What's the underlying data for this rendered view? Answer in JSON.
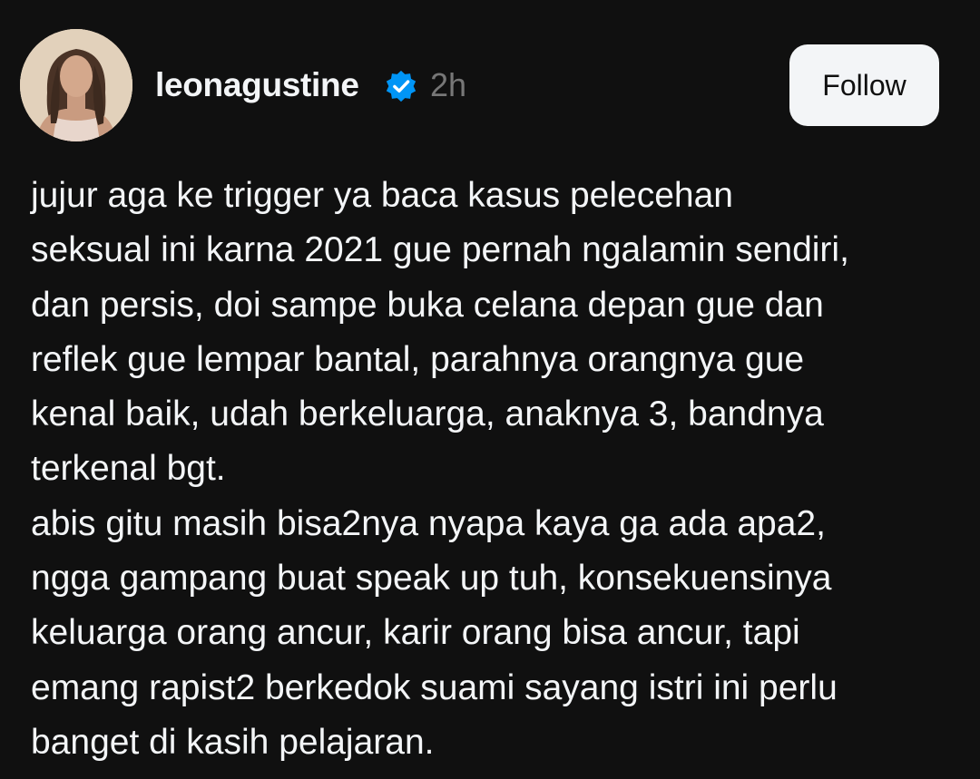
{
  "post": {
    "author": {
      "username": "leonagustine",
      "verified": true,
      "verified_icon": "verified-badge-icon",
      "verified_color": "#0095f6",
      "avatar": "profile-photo"
    },
    "timestamp": "2h",
    "follow_label": "Follow",
    "text_lines": [
      "jujur aga ke trigger ya baca kasus pelecehan",
      "seksual ini karna 2021 gue pernah ngalamin sendiri,",
      "dan persis, doi sampe buka celana depan gue dan",
      "reflek gue lempar bantal, parahnya orangnya gue",
      "kenal baik, udah berkeluarga, anaknya 3, bandnya",
      "terkenal bgt.",
      "abis gitu masih bisa2nya nyapa kaya ga ada apa2,",
      "ngga gampang buat speak up tuh, konsekuensinya",
      "keluarga orang ancur, karir orang bisa ancur, tapi",
      "emang rapist2 berkedok suami sayang istri ini perlu",
      "banget di kasih pelajaran."
    ]
  },
  "theme": {
    "background": "#101010",
    "text": "#f3f5f7",
    "muted": "#777777",
    "button_bg": "#f3f5f7",
    "button_text": "#101010"
  }
}
